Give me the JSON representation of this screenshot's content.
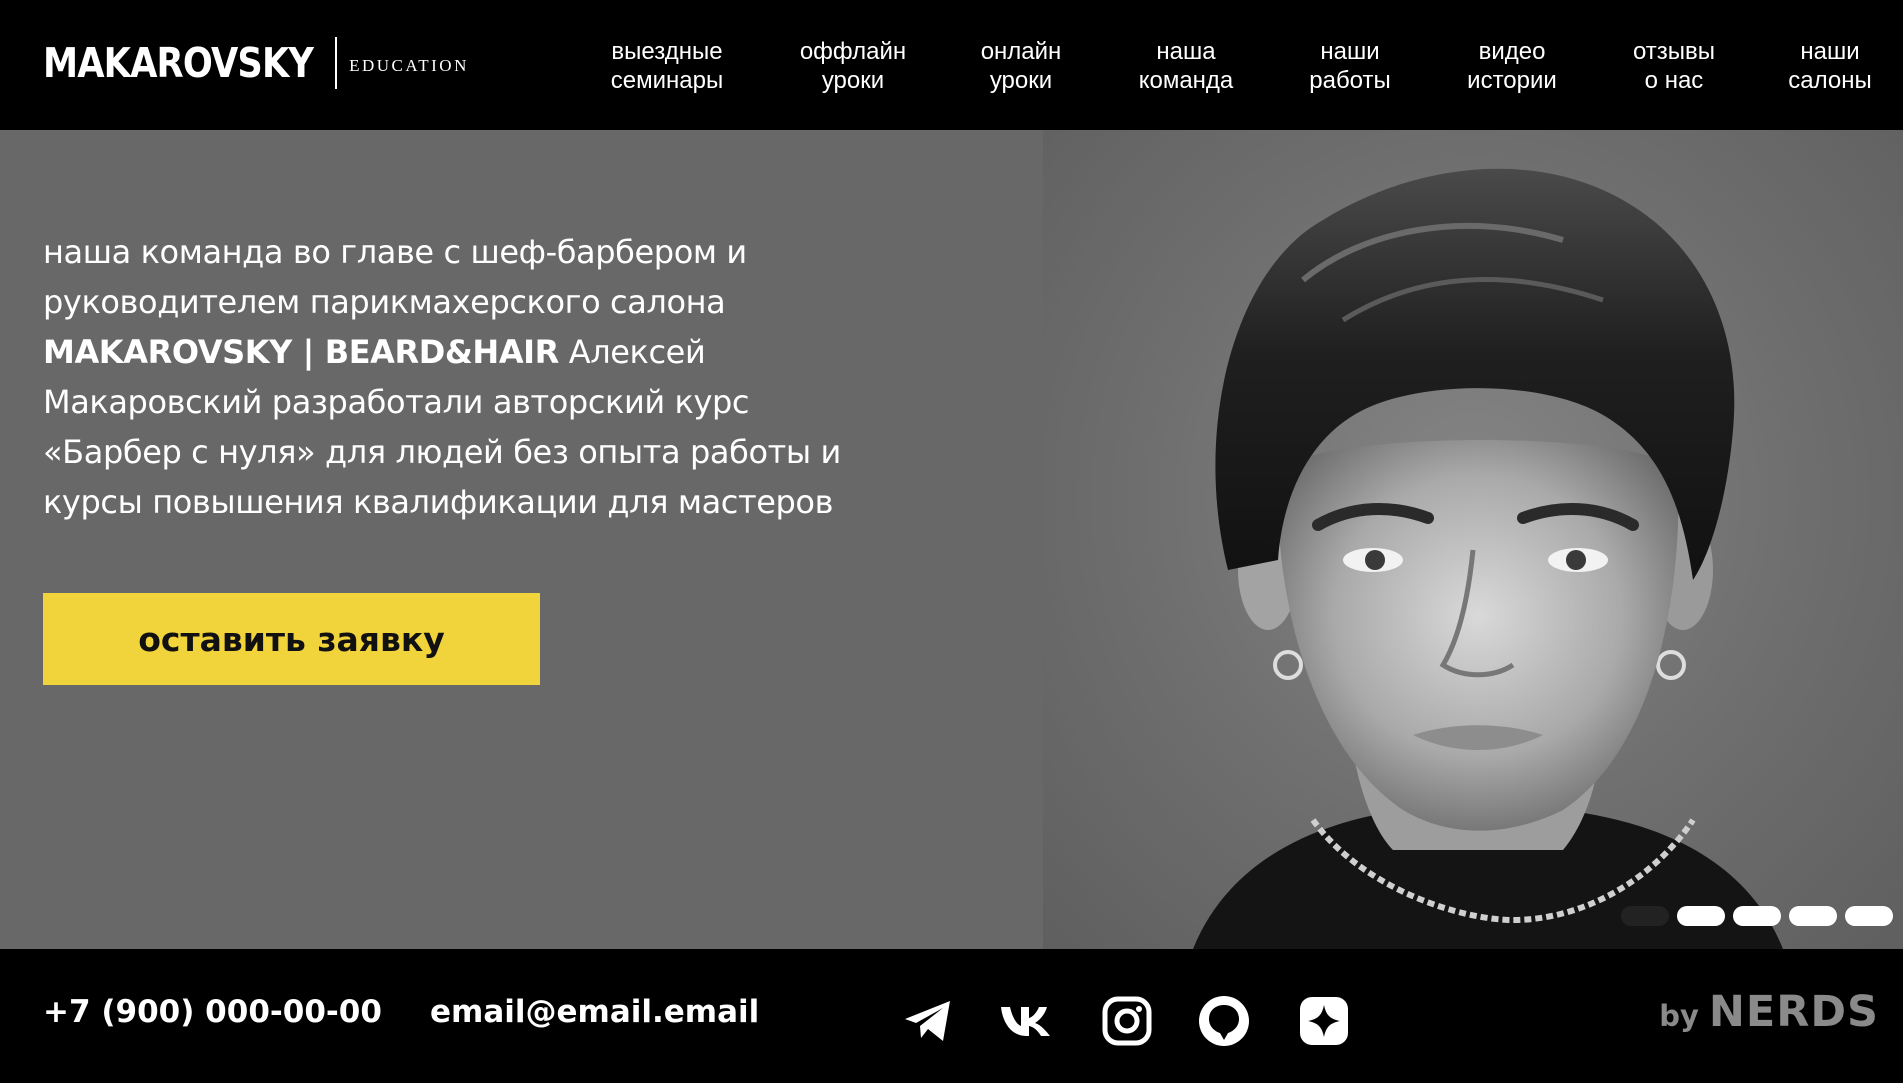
{
  "header": {
    "logo_main": "MAKAROVSKY",
    "logo_sub": "EDUCATION",
    "nav": [
      {
        "line1": "выездные",
        "line2": "семинары"
      },
      {
        "line1": "оффлайн",
        "line2": "уроки"
      },
      {
        "line1": "онлайн",
        "line2": "уроки"
      },
      {
        "line1": "наша",
        "line2": "команда"
      },
      {
        "line1": "наши",
        "line2": "работы"
      },
      {
        "line1": "видео",
        "line2": "истории"
      },
      {
        "line1": "отзывы",
        "line2": "о нас"
      },
      {
        "line1": "наши",
        "line2": "салоны"
      }
    ]
  },
  "hero": {
    "text_part1": "наша команда во главе с шеф-барбером и руководителем парикмахерского салона ",
    "text_bold": "MAKAROVSKY | BEARD&HAIR",
    "text_part2": " Алексей Макаровский разработали авторский курс «Барбер с нуля» для людей без опыта работы и курсы повышения квалификации для мастеров",
    "cta_label": "оставить заявку",
    "slider": {
      "count": 5,
      "active_index": 0
    }
  },
  "footer": {
    "phone": "+7 (900) 000-00-00",
    "email": "email@email.email",
    "social_icons": [
      "telegram-icon",
      "vk-icon",
      "instagram-icon",
      "chat-icon",
      "sparkle-icon"
    ],
    "by_label": "by",
    "nerds_label": "NERDS"
  },
  "colors": {
    "header_bg": "#000000",
    "hero_bg": "#686868",
    "accent": "#f1d33b",
    "footer_muted": "#8a8a8a"
  }
}
